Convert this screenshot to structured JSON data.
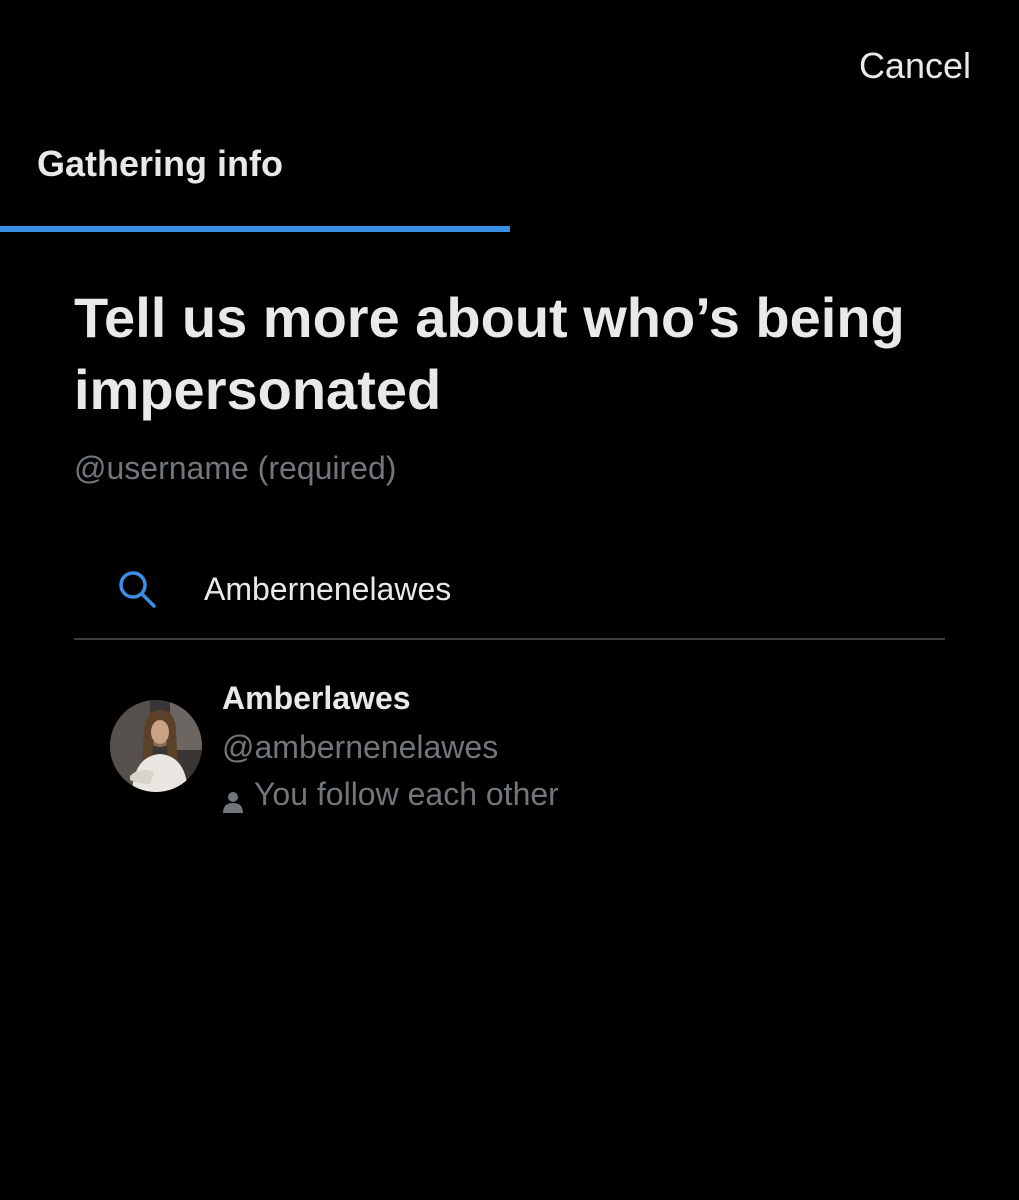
{
  "header": {
    "cancel_label": "Cancel",
    "step_label": "Gathering info",
    "progress_fraction": 0.5
  },
  "main": {
    "headline": "Tell us more about who’s being impersonated",
    "subhead": "@username (required)",
    "search": {
      "icon": "search-icon",
      "value": "Ambernenelawes"
    },
    "results": [
      {
        "display_name": "Amberlawes",
        "handle": "@ambernenelawes",
        "relation_icon": "person-icon",
        "relation": "You follow each other"
      }
    ]
  },
  "colors": {
    "background": "#000000",
    "primary_text": "#e7e9ea",
    "secondary_text": "#71767b",
    "accent": "#3b8ee6",
    "divider": "#3a3d42"
  }
}
